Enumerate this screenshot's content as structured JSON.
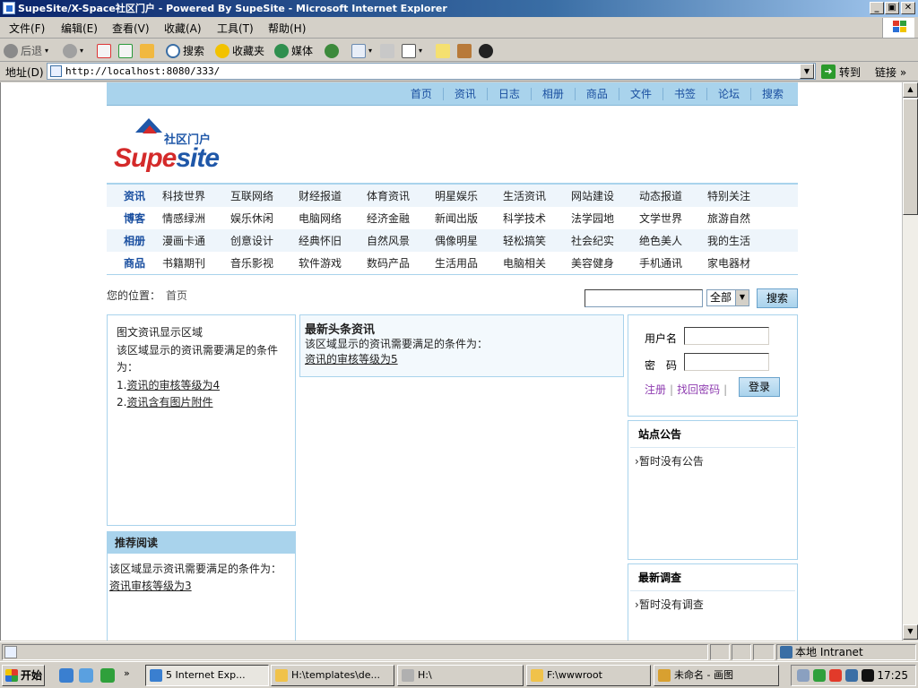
{
  "window": {
    "title": "SupeSite/X-Space社区门户 - Powered By SupeSite - Microsoft Internet Explorer",
    "min_label": "_",
    "max_label": "▣",
    "close_label": "✕"
  },
  "menubar": [
    "文件(F)",
    "编辑(E)",
    "查看(V)",
    "收藏(A)",
    "工具(T)",
    "帮助(H)"
  ],
  "toolbar": {
    "back": "后退",
    "search": "搜索",
    "favorites": "收藏夹",
    "media": "媒体"
  },
  "address": {
    "label": "地址(D)",
    "url": "http://localhost:8080/333/",
    "go": "转到",
    "links": "链接",
    "links_arrow": "»"
  },
  "site": {
    "topnav": [
      "首页",
      "资讯",
      "日志",
      "相册",
      "商品",
      "文件",
      "书签",
      "论坛",
      "搜索"
    ],
    "logo_sub": "社区门户",
    "logo_main_a": "Supe",
    "logo_main_b": "site",
    "categories": [
      {
        "head": "资讯",
        "items": [
          "科技世界",
          "互联网络",
          "财经报道",
          "体育资讯",
          "明星娱乐",
          "生活资讯",
          "网站建设",
          "动态报道",
          "特别关注"
        ]
      },
      {
        "head": "博客",
        "items": [
          "情感绿洲",
          "娱乐休闲",
          "电脑网络",
          "经济金融",
          "新闻出版",
          "科学技术",
          "法学园地",
          "文学世界",
          "旅游自然"
        ]
      },
      {
        "head": "相册",
        "items": [
          "漫画卡通",
          "创意设计",
          "经典怀旧",
          "自然风景",
          "偶像明星",
          "轻松搞笑",
          "社会纪实",
          "绝色美人",
          "我的生活"
        ]
      },
      {
        "head": "商品",
        "items": [
          "书籍期刊",
          "音乐影视",
          "软件游戏",
          "数码产品",
          "生活用品",
          "电脑相关",
          "美容健身",
          "手机通讯",
          "家电器材"
        ]
      }
    ],
    "location_label": "您的位置：",
    "location_home": "首页",
    "search_select": "全部",
    "search_button": "搜索",
    "image_box": {
      "line1": "图文资讯显示区域",
      "line2": "该区域显示的资讯需要满足的条件为：",
      "cond1_num": "1.",
      "cond1": "资讯的审核等级为4",
      "cond2_num": "2.",
      "cond2": "资讯含有图片附件"
    },
    "recommend": {
      "title": "推荐阅读",
      "line1": "该区域显示资讯需要满足的条件为：",
      "line2": "资讯审核等级为3"
    },
    "headline": {
      "title": "最新头条资讯",
      "line1": "该区域显示的资讯需要满足的条件为：",
      "line2": "资讯的审核等级为5"
    },
    "login": {
      "user_label": "用户名",
      "pass_label": "密　码",
      "register": "注册",
      "sep": "|",
      "forgot": "找回密码",
      "button": "登录"
    },
    "notice": {
      "title": "站点公告",
      "empty": "暂时没有公告"
    },
    "survey": {
      "title": "最新调查",
      "empty": "暂时没有调查"
    }
  },
  "statusbar": {
    "zone": "本地 Intranet"
  },
  "taskbar": {
    "start": "开始",
    "tasks": [
      "5 Internet Exp...",
      "H:\\templates\\de...",
      "H:\\",
      "F:\\wwwroot",
      "未命名 - 画图"
    ],
    "clock": "17:25"
  },
  "colors": {
    "accent": "#a9d3ec",
    "link": "#1a4fa0",
    "brand_red": "#d42a2a"
  }
}
